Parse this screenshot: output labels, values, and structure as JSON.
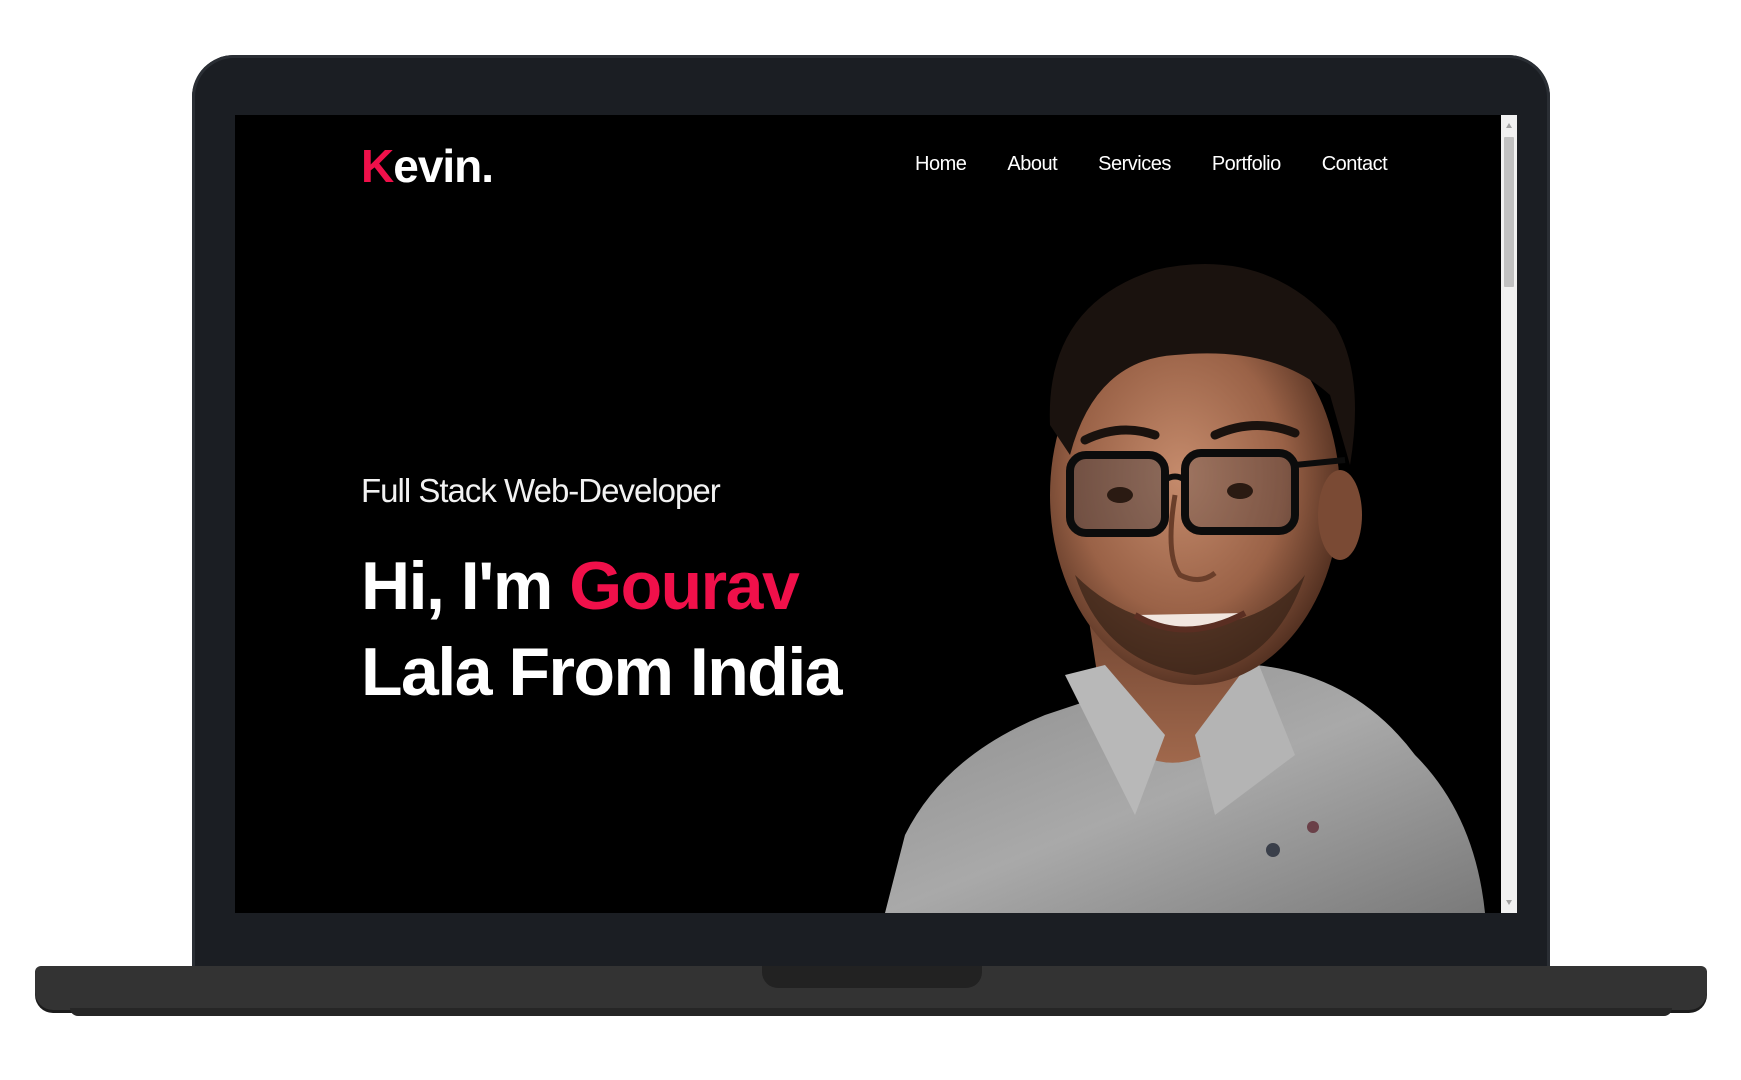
{
  "site": {
    "logo": {
      "first_letter": "K",
      "rest": "evin."
    },
    "nav": [
      {
        "label": "Home"
      },
      {
        "label": "About"
      },
      {
        "label": "Services"
      },
      {
        "label": "Portfolio"
      },
      {
        "label": "Contact"
      }
    ],
    "hero": {
      "subtitle": "Full Stack Web-Developer",
      "headline_prefix": "Hi, I'm ",
      "headline_name": "Gourav",
      "headline_line2": "Lala From India"
    }
  },
  "colors": {
    "accent": "#f0104a",
    "background": "#000000",
    "text": "#ffffff",
    "laptop_body": "#1b1e23"
  },
  "icons": {
    "scroll_up": "chevron-up-icon",
    "scroll_down": "chevron-down-icon"
  }
}
